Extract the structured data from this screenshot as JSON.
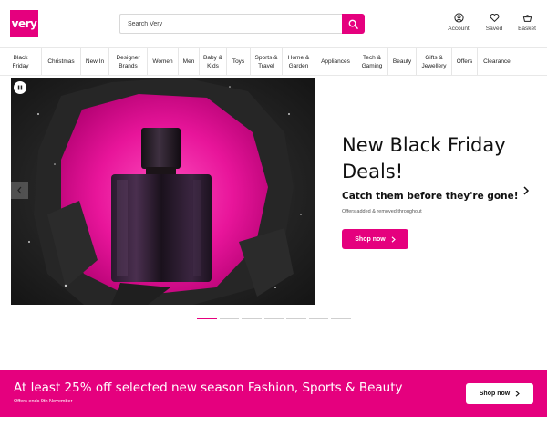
{
  "brand": {
    "logo_text": "very",
    "accent_color": "#e5007e"
  },
  "search": {
    "placeholder": "Search Very",
    "icon": "search-icon"
  },
  "header_actions": [
    {
      "label": "Account",
      "icon": "account-icon"
    },
    {
      "label": "Saved",
      "icon": "heart-icon"
    },
    {
      "label": "Basket",
      "icon": "basket-icon"
    }
  ],
  "nav": {
    "items": [
      {
        "label": "Black\nFriday"
      },
      {
        "label": "Christmas"
      },
      {
        "label": "New In"
      },
      {
        "label": "Designer\nBrands"
      },
      {
        "label": "Women"
      },
      {
        "label": "Men"
      },
      {
        "label": "Baby &\nKids"
      },
      {
        "label": "Toys"
      },
      {
        "label": "Sports &\nTravel"
      },
      {
        "label": "Home &\nGarden"
      },
      {
        "label": "Appliances"
      },
      {
        "label": "Tech &\nGaming"
      },
      {
        "label": "Beauty"
      },
      {
        "label": "Gifts &\nJewellery"
      },
      {
        "label": "Offers"
      },
      {
        "label": "Clearance"
      }
    ]
  },
  "hero": {
    "title": "New Black Friday Deals!",
    "subtitle": "Catch them before they're gone!",
    "note": "Offers added & removed throughout",
    "cta": "Shop now",
    "image": "perfume-bottle-hero-image",
    "slide_count": 7,
    "active_slide": 1
  },
  "promo": {
    "title": "At least 25% off selected new season Fashion, Sports & Beauty",
    "note": "Offers ends 9th November",
    "cta": "Shop now"
  }
}
